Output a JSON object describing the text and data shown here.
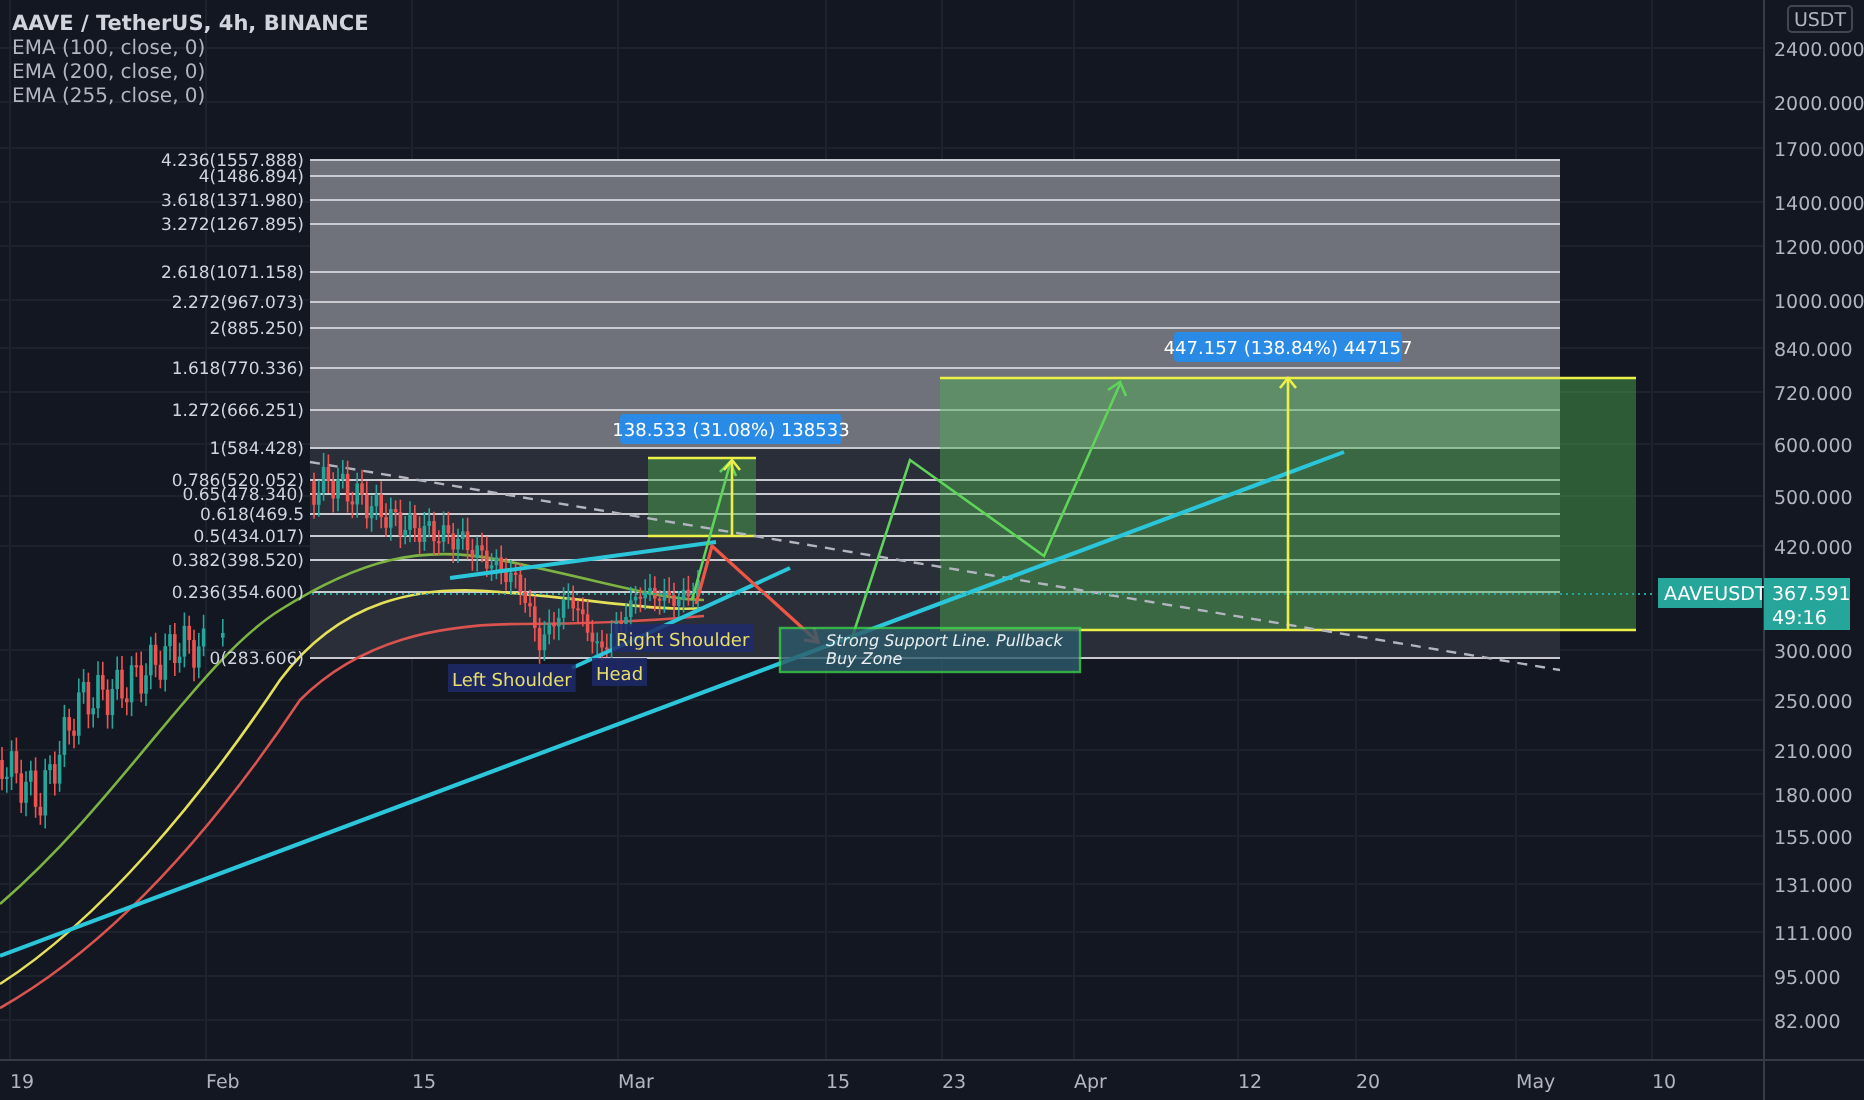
{
  "legend": {
    "title": "AAVE / TetherUS, 4h, BINANCE",
    "indicators": [
      "EMA (100, close, 0)",
      "EMA (200, close, 0)",
      "EMA (255, close, 0)"
    ]
  },
  "fib_levels": [
    "4.236(1557.888)",
    "4(1486.894)",
    "3.618(1371.980)",
    "3.272(1267.895)",
    "2.618(1071.158)",
    "2.272(967.073)",
    "2(885.250)",
    "1.618(770.336)",
    "1.272(666.251)",
    "1(584.428)",
    "0.786(520.052)",
    "0.65(478.340)",
    "0.618(469.5",
    "0.5(434.017)",
    "0.382(398.520)",
    "0.236(354.600)",
    "0(283.606)"
  ],
  "annotations": {
    "left_shoulder": "Left Shoulder",
    "head": "Head",
    "right_shoulder": "Right Shoulder",
    "support_note": [
      "Strong Support Line. Pullback",
      "Buy Zone"
    ]
  },
  "measurements": [
    {
      "label": "138.533 (31.08%) 138533"
    },
    {
      "label": "447.157 (138.84%) 447157"
    }
  ],
  "price_scale": {
    "unit": "USDT",
    "labels": [
      "2400.000",
      "2000.000",
      "1700.000",
      "1400.000",
      "1200.000",
      "1000.000",
      "840.000",
      "720.000",
      "600.000",
      "500.000",
      "420.000",
      "300.000",
      "250.000",
      "210.000",
      "180.000",
      "155.000",
      "131.000",
      "111.000",
      "95.000",
      "82.000"
    ]
  },
  "last_price": {
    "symbol": "AAVEUSDT",
    "price": "367.591",
    "countdown": "49:16"
  },
  "time_scale": {
    "labels": [
      "19",
      "Feb",
      "15",
      "Mar",
      "15",
      "23",
      "Apr",
      "12",
      "20",
      "May",
      "10"
    ]
  }
}
